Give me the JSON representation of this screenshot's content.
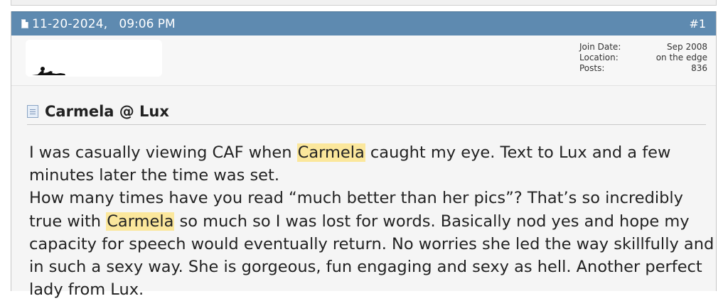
{
  "post": {
    "date": "11-20-2024,",
    "time": "09:06 PM",
    "number": "#1"
  },
  "user_info": {
    "join_label": "Join Date:",
    "join_value": "Sep 2008",
    "location_label": "Location:",
    "location_value": "on the edge",
    "posts_label": "Posts:",
    "posts_value": "836"
  },
  "thread": {
    "title": "Carmela @ Lux"
  },
  "body": {
    "p1_a": "I was casually viewing CAF when ",
    "p1_hl": "Carmela",
    "p1_b": " caught my eye. Text to Lux and a few minutes later the time was set.",
    "p2_a": "How many times have you read “much better than her pics”? That’s so incredibly true with ",
    "p2_hl": "Carmela",
    "p2_b": " so much so I was lost for words. Basically nod yes and hope my capacity for speech would eventually return. No worries she led the way skillfully and in such a sexy way. She is gorgeous, fun engaging and sexy as hell. Another perfect lady from Lux."
  },
  "colors": {
    "header_bar": "#5e8ab0",
    "highlight": "#fbe79c"
  },
  "icons": {
    "post_icon": "document-icon",
    "title_icon": "document-icon",
    "avatar": "reclining-figure"
  }
}
